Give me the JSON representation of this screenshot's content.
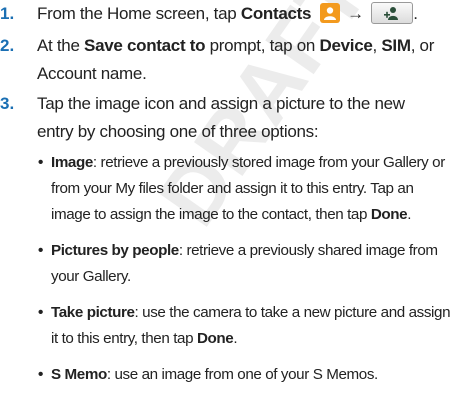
{
  "watermark": "DRAFT For Internal Use Only",
  "steps": [
    {
      "number": "1.",
      "parts": [
        "From the Home screen, tap ",
        "Contacts",
        " ",
        "→",
        " ",
        "."
      ]
    },
    {
      "number": "2.",
      "line1": [
        "At the ",
        "Save contact to",
        " prompt, tap on ",
        "Device",
        ", ",
        "SIM",
        ", or"
      ],
      "line2": "Account name."
    },
    {
      "number": "3.",
      "line1": "Tap the image icon and assign a picture to the new",
      "line2": "entry by choosing one of three options:"
    }
  ],
  "bullets": [
    {
      "title": "Image",
      "line1": ": retrieve a previously stored image from your Gallery or",
      "line2_pre": "from your My files folder and assign it to this entry. Tap an",
      "line3_pre": "image to assign the image to the contact, then tap ",
      "line3_bold": "Done",
      "line3_post": "."
    },
    {
      "title": "Pictures by people",
      "line1": ": retrieve a previously shared image from",
      "line2_pre": "your Gallery."
    },
    {
      "title": "Take picture",
      "line1": ": use the camera to take a new picture and assign",
      "line2_pre": "it to this entry, then tap ",
      "line2_bold": "Done",
      "line2_post": "."
    },
    {
      "title": "S Memo",
      "line1": ": use an image from one of your S Memos."
    }
  ],
  "bullet_char": "•",
  "icons": {
    "contacts": "contacts-app-icon",
    "add": "add-contact-icon"
  },
  "colors": {
    "step_number": "#1a6fb3",
    "contacts_icon": "#f39a1e"
  }
}
